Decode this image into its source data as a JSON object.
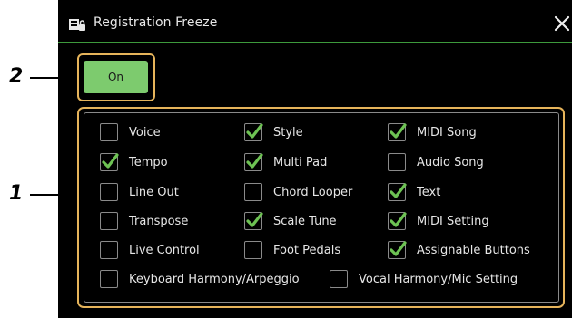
{
  "callouts": {
    "on_group": "2",
    "options_group": "1"
  },
  "dialog": {
    "title": "Registration Freeze",
    "title_icon": "registration-lock-icon",
    "close_icon": "close-icon"
  },
  "on_button": {
    "label": "On",
    "active": true
  },
  "colors": {
    "accent_green": "#7dcb6e",
    "check_green": "#6dc253",
    "highlight_frame": "#e6b45b",
    "title_rule": "#3d9a3c",
    "background": "#000000"
  },
  "options": [
    {
      "key": "voice",
      "label": "Voice",
      "checked": false
    },
    {
      "key": "style",
      "label": "Style",
      "checked": true
    },
    {
      "key": "midi_song",
      "label": "MIDI Song",
      "checked": true
    },
    {
      "key": "tempo",
      "label": "Tempo",
      "checked": true
    },
    {
      "key": "multi_pad",
      "label": "Multi Pad",
      "checked": true
    },
    {
      "key": "audio_song",
      "label": "Audio Song",
      "checked": false
    },
    {
      "key": "line_out",
      "label": "Line Out",
      "checked": false
    },
    {
      "key": "chord_looper",
      "label": "Chord Looper",
      "checked": false
    },
    {
      "key": "text",
      "label": "Text",
      "checked": true
    },
    {
      "key": "transpose",
      "label": "Transpose",
      "checked": false
    },
    {
      "key": "scale_tune",
      "label": "Scale Tune",
      "checked": true
    },
    {
      "key": "midi_setting",
      "label": "MIDI Setting",
      "checked": true
    },
    {
      "key": "live_control",
      "label": "Live Control",
      "checked": false
    },
    {
      "key": "foot_pedals",
      "label": "Foot Pedals",
      "checked": false
    },
    {
      "key": "assignable_buttons",
      "label": "Assignable Buttons",
      "checked": true
    },
    {
      "key": "keyboard_harmony",
      "label": "Keyboard Harmony/Arpeggio",
      "checked": false
    },
    {
      "key": "vocal_harmony",
      "label": "Vocal Harmony/Mic Setting",
      "checked": false
    }
  ]
}
